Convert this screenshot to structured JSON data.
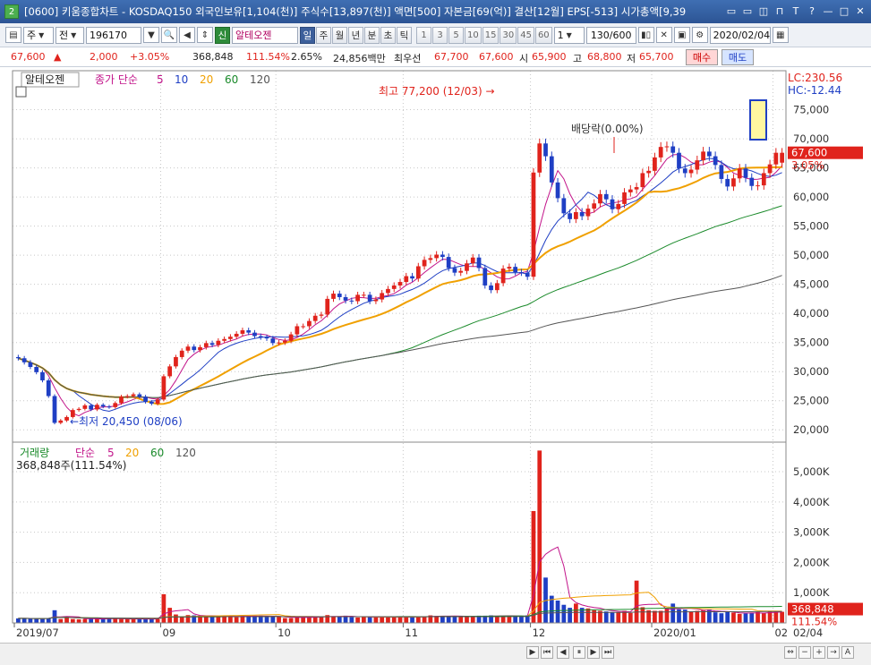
{
  "window": {
    "number": "2",
    "title": "[0600] 키움종합차트 - KOSDAQ150 외국인보유[1,104(천)] 주식수[13,897(천)] 액면[500] 자본금[69(억)] 결산[12월] EPS[-513] 시가총액[9,39",
    "buttons": [
      "▭",
      "▭",
      "◫",
      "⊓",
      "T",
      "?",
      "—",
      "□",
      "✕"
    ]
  },
  "toolbar": {
    "market": "주",
    "type": "전",
    "code": "196170",
    "tag": "신",
    "stock_name": "알테오젠",
    "periods": [
      "일",
      "주",
      "월",
      "년",
      "분",
      "초",
      "틱"
    ],
    "active_period": "일",
    "intervals": [
      "1",
      "3",
      "5",
      "10",
      "15",
      "30",
      "45",
      "60"
    ],
    "interval_input": "1",
    "count": "130/600",
    "date": "2020/02/04"
  },
  "quote": {
    "price": "67,600",
    "arrow": "▲",
    "change": "2,000",
    "change_rate": "+3.05%",
    "volume": "368,848",
    "volume_ratio": "111.54%",
    "turnover": "2.65%",
    "amount": "24,856백만",
    "pref_label": "최우선",
    "ask": "67,700",
    "bid": "67,600",
    "open_label": "시",
    "open": "65,900",
    "high_label": "고",
    "high": "68,800",
    "low_label": "저",
    "low": "65,700",
    "buy_btn": "매수",
    "sell_btn": "매도"
  },
  "price_panel": {
    "stock_label": "알테오젠",
    "ma_label": "종가 단순",
    "ma_periods": [
      "5",
      "10",
      "20",
      "60",
      "120"
    ],
    "ma_colors": [
      "#c2148a",
      "#1f3fc4",
      "#f0a000",
      "#1a8a2a",
      "#555555"
    ],
    "high_annot": "최고 77,200 (12/03)",
    "low_annot": "최저 20,450 (08/06)",
    "dividend_annot": "배당락(0.00%)",
    "lc": "LC:230.56",
    "hc": "HC:-12.44",
    "last_price": "67,600",
    "last_rate": "3.05%",
    "y_ticks": [
      "75,000",
      "70,000",
      "65,000",
      "60,000",
      "55,000",
      "50,000",
      "45,000",
      "40,000",
      "35,000",
      "30,000",
      "25,000",
      "20,000"
    ]
  },
  "volume_panel": {
    "label": "거래량",
    "ma_label": "단순",
    "ma_periods": [
      "5",
      "20",
      "60",
      "120"
    ],
    "current": "368,848주(111.54%)",
    "last_volume": "368,848",
    "last_ratio": "111.54%",
    "y_ticks": [
      "5,000K",
      "4,000K",
      "3,000K",
      "2,000K",
      "1,000K"
    ]
  },
  "x_axis": {
    "labels": [
      "2019/07",
      "09",
      "10",
      "11",
      "12",
      "2020/01",
      "02"
    ],
    "right_label": "02/04"
  },
  "chart_data": {
    "type": "candlestick",
    "x": [
      "2019-07-29",
      "2019-07-30",
      "2019-07-31",
      "2019-08-01",
      "2019-08-02",
      "2019-08-05",
      "2019-08-06",
      "2019-08-07",
      "2019-08-08",
      "2019-08-09",
      "2019-08-12",
      "2019-08-13",
      "2019-08-14",
      "2019-08-16",
      "2019-08-19",
      "2019-08-20",
      "2019-08-21",
      "2019-08-22",
      "2019-08-23",
      "2019-08-26",
      "2019-08-27",
      "2019-08-28",
      "2019-08-29",
      "2019-08-30",
      "2019-09-02",
      "2019-09-03",
      "2019-09-04",
      "2019-09-05",
      "2019-09-06",
      "2019-09-09",
      "2019-09-10",
      "2019-09-11",
      "2019-09-16",
      "2019-09-17",
      "2019-09-18",
      "2019-09-19",
      "2019-09-20",
      "2019-09-23",
      "2019-09-24",
      "2019-09-25",
      "2019-09-26",
      "2019-09-27",
      "2019-09-30",
      "2019-10-01",
      "2019-10-02",
      "2019-10-04",
      "2019-10-07",
      "2019-10-08",
      "2019-10-10",
      "2019-10-11",
      "2019-10-14",
      "2019-10-15",
      "2019-10-16",
      "2019-10-17",
      "2019-10-18",
      "2019-10-21",
      "2019-10-22",
      "2019-10-23",
      "2019-10-24",
      "2019-10-25",
      "2019-10-28",
      "2019-10-29",
      "2019-10-30",
      "2019-10-31",
      "2019-11-01",
      "2019-11-04",
      "2019-11-05",
      "2019-11-06",
      "2019-11-07",
      "2019-11-08",
      "2019-11-11",
      "2019-11-12",
      "2019-11-13",
      "2019-11-14",
      "2019-11-15",
      "2019-11-18",
      "2019-11-19",
      "2019-11-20",
      "2019-11-21",
      "2019-11-22",
      "2019-11-25",
      "2019-11-26",
      "2019-11-27",
      "2019-11-28",
      "2019-11-29",
      "2019-12-02",
      "2019-12-03",
      "2019-12-04",
      "2019-12-05",
      "2019-12-06",
      "2019-12-09",
      "2019-12-10",
      "2019-12-11",
      "2019-12-12",
      "2019-12-13",
      "2019-12-16",
      "2019-12-17",
      "2019-12-18",
      "2019-12-19",
      "2019-12-20",
      "2019-12-23",
      "2019-12-24",
      "2019-12-26",
      "2019-12-27",
      "2019-12-30",
      "2020-01-02",
      "2020-01-03",
      "2020-01-06",
      "2020-01-07",
      "2020-01-08",
      "2020-01-09",
      "2020-01-10",
      "2020-01-13",
      "2020-01-14",
      "2020-01-15",
      "2020-01-16",
      "2020-01-17",
      "2020-01-20",
      "2020-01-21",
      "2020-01-22",
      "2020-01-23",
      "2020-01-28",
      "2020-01-29",
      "2020-01-30",
      "2020-01-31",
      "2020-02-03",
      "2020-02-04"
    ],
    "open": [
      32500,
      32300,
      31600,
      30800,
      29900,
      28500,
      25800,
      21200,
      21600,
      22200,
      23400,
      23600,
      24200,
      23500,
      24300,
      24000,
      23900,
      24600,
      25700,
      25800,
      26100,
      25700,
      24800,
      24500,
      25200,
      29200,
      30900,
      32500,
      33600,
      34300,
      33700,
      34200,
      34900,
      34600,
      35300,
      35600,
      36000,
      36500,
      37100,
      36700,
      36100,
      35900,
      35700,
      34900,
      35000,
      35300,
      36400,
      37800,
      37800,
      38700,
      39600,
      39800,
      42500,
      43400,
      42800,
      42200,
      42100,
      43200,
      43200,
      42100,
      42400,
      43500,
      44200,
      44800,
      45400,
      46400,
      46000,
      48100,
      49200,
      49500,
      50100,
      49700,
      47800,
      47000,
      47300,
      48600,
      49600,
      47800,
      44800,
      44000,
      45200,
      47700,
      48000,
      47100,
      47000,
      46300,
      64200,
      69200,
      67000,
      62500,
      59800,
      57200,
      56200,
      57400,
      56700,
      58000,
      58900,
      60500,
      59600,
      57900,
      58800,
      60800,
      61300,
      61700,
      64100,
      64500,
      66800,
      68600,
      68700,
      67600,
      64900,
      64100,
      64700,
      66300,
      67800,
      67000,
      65500,
      63100,
      61800,
      63200,
      64900,
      63300,
      61900,
      62000,
      64100,
      65600,
      65900
    ],
    "close": [
      32300,
      31600,
      30800,
      29900,
      28500,
      25800,
      21200,
      21600,
      22200,
      23400,
      23600,
      24200,
      23500,
      24300,
      24000,
      23900,
      24600,
      25700,
      25800,
      26100,
      25700,
      24800,
      24500,
      25200,
      29200,
      30900,
      32500,
      33600,
      34300,
      33700,
      34200,
      34900,
      34600,
      35300,
      35600,
      36000,
      36500,
      37100,
      36700,
      36100,
      35900,
      35700,
      34900,
      35000,
      35300,
      36400,
      37800,
      37800,
      38700,
      39600,
      39800,
      42500,
      43400,
      42800,
      42200,
      42100,
      43200,
      43200,
      42100,
      42400,
      43500,
      44200,
      44800,
      45400,
      46400,
      46000,
      48100,
      49200,
      49500,
      50100,
      49700,
      47800,
      47000,
      47300,
      48600,
      49600,
      47800,
      44800,
      44000,
      45200,
      47700,
      48000,
      47100,
      47000,
      46300,
      64200,
      69200,
      67000,
      62500,
      59800,
      57200,
      56200,
      57400,
      56700,
      58000,
      58900,
      60500,
      59600,
      57900,
      58800,
      60800,
      61300,
      61700,
      64100,
      64500,
      66800,
      68600,
      68700,
      67600,
      64900,
      64100,
      64700,
      66300,
      67800,
      67000,
      65500,
      63100,
      61800,
      63200,
      64900,
      63300,
      61900,
      62000,
      64100,
      65600,
      67600,
      67600
    ],
    "volume": [
      150,
      150,
      140,
      140,
      150,
      160,
      420,
      130,
      200,
      130,
      120,
      130,
      140,
      150,
      130,
      140,
      140,
      130,
      130,
      130,
      130,
      130,
      130,
      140,
      950,
      500,
      280,
      210,
      260,
      250,
      240,
      220,
      220,
      210,
      230,
      240,
      190,
      230,
      220,
      240,
      240,
      200,
      210,
      200,
      160,
      160,
      190,
      190,
      200,
      210,
      190,
      260,
      200,
      220,
      240,
      190,
      180,
      200,
      200,
      190,
      200,
      180,
      200,
      200,
      200,
      200,
      200,
      210,
      250,
      230,
      230,
      210,
      230,
      220,
      200,
      200,
      240,
      240,
      250,
      230,
      210,
      250,
      230,
      210,
      250,
      3700,
      5700,
      1500,
      900,
      740,
      600,
      500,
      640,
      500,
      480,
      420,
      400,
      380,
      360,
      360,
      400,
      330,
      1400,
      520,
      420,
      400,
      400,
      480,
      640,
      450,
      440,
      380,
      400,
      420,
      440,
      350,
      320,
      360,
      340,
      300,
      310,
      330,
      360,
      330,
      370,
      370,
      369
    ],
    "ylim": [
      18500,
      77700
    ],
    "volume_unit": "K",
    "volume_ylim": [
      0,
      5800
    ]
  }
}
